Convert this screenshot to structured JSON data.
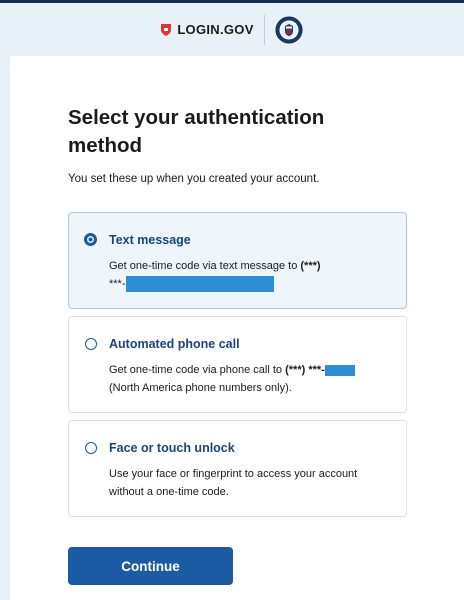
{
  "header": {
    "brand": "LOGIN.GOV",
    "brand_color": "#d83933"
  },
  "main": {
    "title": "Select your authentication method",
    "subtitle": "You set these up when you created your account.",
    "options": [
      {
        "label": "Text message",
        "desc_before": "Get one-time code via text message to ",
        "desc_bold": "(***)",
        "desc_line2": "***-",
        "selected": true
      },
      {
        "label": "Automated phone call",
        "desc_before": "Get one-time code via phone call to ",
        "desc_bold": "(***) ***-",
        "desc_line2": "(North America phone numbers only).",
        "selected": false
      },
      {
        "label": "Face or touch unlock",
        "desc": "Use your face or fingerprint to access your account without a one-time code.",
        "selected": false
      }
    ],
    "continue_label": "Continue"
  },
  "colors": {
    "accent": "#1a5ba3",
    "heading_link": "#1a4480",
    "selected_bg": "#eff6fb",
    "redaction": "#2c8fd6"
  }
}
